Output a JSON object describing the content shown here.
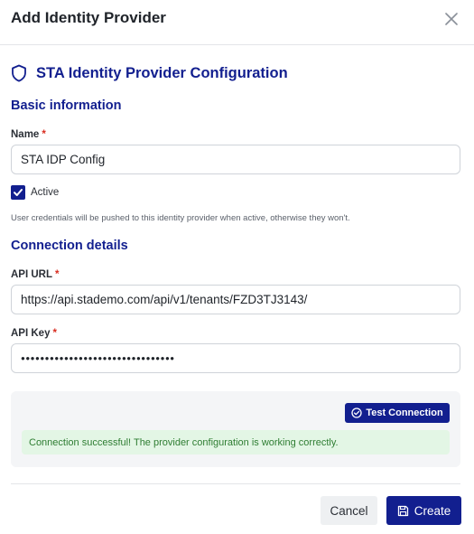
{
  "dialog": {
    "title": "Add Identity Provider",
    "close_icon": "close-icon"
  },
  "section": {
    "icon": "shield-icon",
    "title": "STA Identity Provider Configuration"
  },
  "basic": {
    "heading": "Basic information",
    "name_label": "Name",
    "name_required": "*",
    "name_value": "STA IDP Config",
    "active_label": "Active",
    "active_checked": true,
    "helper_text": "User credentials will be pushed to this identity provider when active, otherwise they won't."
  },
  "connection": {
    "heading": "Connection details",
    "api_url_label": "API URL",
    "api_url_required": "*",
    "api_url_value": "https://api.stademo.com/api/v1/tenants/FZD3TJ3143/",
    "api_key_label": "API Key",
    "api_key_required": "*",
    "api_key_value": "●●●●●●●●●●●●●●●●●●●●●●●●●●●●●●●●"
  },
  "test": {
    "button_label": "Test Connection",
    "button_icon": "check-circle-icon",
    "success_message": "Connection successful! The provider configuration is working correctly."
  },
  "footer": {
    "cancel_label": "Cancel",
    "create_label": "Create",
    "create_icon": "save-icon"
  },
  "colors": {
    "primary": "#121f8f",
    "success_bg": "#e3f6e5",
    "success_text": "#2e7d32",
    "required": "#d92d20"
  }
}
